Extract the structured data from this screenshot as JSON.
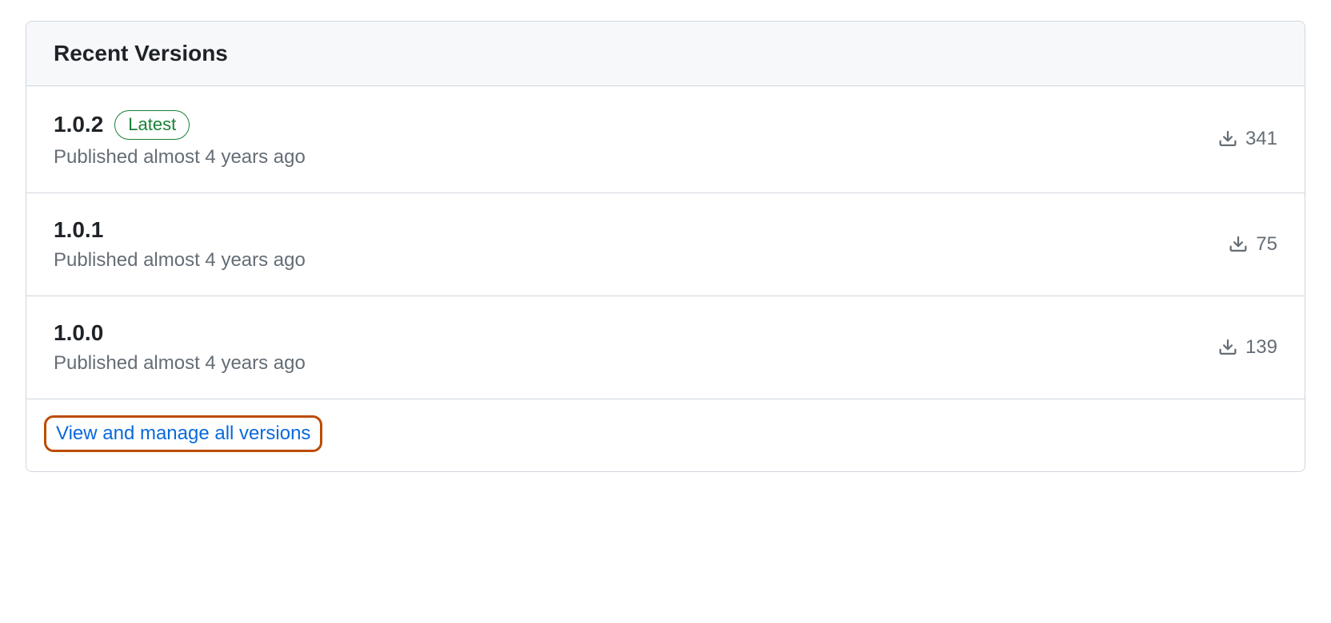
{
  "header": {
    "title": "Recent Versions"
  },
  "versions": [
    {
      "number": "1.0.2",
      "badge": "Latest",
      "published": "Published almost 4 years ago",
      "downloads": "341"
    },
    {
      "number": "1.0.1",
      "badge": null,
      "published": "Published almost 4 years ago",
      "downloads": "75"
    },
    {
      "number": "1.0.0",
      "badge": null,
      "published": "Published almost 4 years ago",
      "downloads": "139"
    }
  ],
  "footer": {
    "manage_link": "View and manage all versions"
  }
}
